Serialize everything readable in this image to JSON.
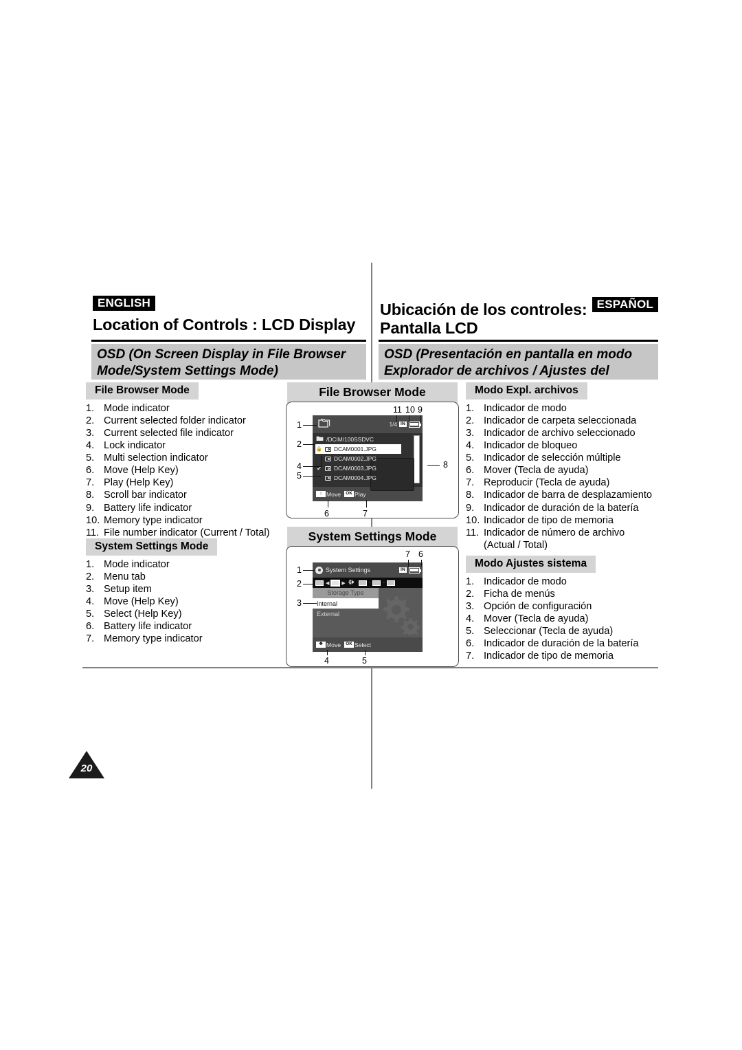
{
  "page": {
    "number": "20"
  },
  "header": {
    "english": {
      "badge": "ENGLISH",
      "title": "Location of Controls : LCD Display",
      "subtitle": "OSD (On Screen Display in File Browser Mode/System Settings Mode)"
    },
    "spanish": {
      "badge": "ESPAÑOL",
      "title_line1": "Ubicación de los controles:",
      "title_line2": "Pantalla LCD",
      "subtitle": "OSD (Presentación en pantalla en modo Explorador de archivos / Ajustes del sistema)"
    }
  },
  "sections": {
    "en_file_browser": {
      "title": "File Browser Mode",
      "items": [
        {
          "n": "1.",
          "t": "Mode indicator"
        },
        {
          "n": "2.",
          "t": "Current selected folder indicator"
        },
        {
          "n": "3.",
          "t": "Current selected file indicator"
        },
        {
          "n": "4.",
          "t": "Lock indicator"
        },
        {
          "n": "5.",
          "t": "Multi selection indicator"
        },
        {
          "n": "6.",
          "t": "Move (Help Key)"
        },
        {
          "n": "7.",
          "t": "Play (Help Key)"
        },
        {
          "n": "8.",
          "t": "Scroll bar indicator"
        },
        {
          "n": "9.",
          "t": "Battery life indicator"
        },
        {
          "n": "10.",
          "t": "Memory type indicator"
        },
        {
          "n": "11.",
          "t": "File number indicator (Current / Total)"
        }
      ]
    },
    "en_system_settings": {
      "title": "System Settings Mode",
      "items": [
        {
          "n": "1.",
          "t": "Mode indicator"
        },
        {
          "n": "2.",
          "t": "Menu tab"
        },
        {
          "n": "3.",
          "t": "Setup item"
        },
        {
          "n": "4.",
          "t": "Move (Help Key)"
        },
        {
          "n": "5.",
          "t": "Select (Help Key)"
        },
        {
          "n": "6.",
          "t": "Battery life indicator"
        },
        {
          "n": "7.",
          "t": "Memory type indicator"
        }
      ]
    },
    "es_file_browser": {
      "title": "Modo Expl. archivos",
      "items": [
        {
          "n": "1.",
          "t": "Indicador de modo"
        },
        {
          "n": "2.",
          "t": "Indicador de carpeta seleccionada"
        },
        {
          "n": "3.",
          "t": "Indicador de archivo seleccionado"
        },
        {
          "n": "4.",
          "t": "Indicador de bloqueo"
        },
        {
          "n": "5.",
          "t": "Indicador de selección múltiple"
        },
        {
          "n": "6.",
          "t": "Mover (Tecla de ayuda)"
        },
        {
          "n": "7.",
          "t": "Reproducir (Tecla de ayuda)"
        },
        {
          "n": "8.",
          "t": "Indicador de barra de desplazamiento"
        },
        {
          "n": "9.",
          "t": "Indicador de duración de la batería"
        },
        {
          "n": "10.",
          "t": "Indicador de tipo de memoria"
        },
        {
          "n": "11.",
          "t": "Indicador de número de archivo"
        },
        {
          "n": "",
          "t": "(Actual / Total)",
          "cont": true
        }
      ]
    },
    "es_system_settings": {
      "title": "Modo Ajustes sistema",
      "items": [
        {
          "n": "1.",
          "t": "Indicador de modo"
        },
        {
          "n": "2.",
          "t": "Ficha de menús"
        },
        {
          "n": "3.",
          "t": "Opción de configuración"
        },
        {
          "n": "4.",
          "t": "Mover (Tecla de ayuda)"
        },
        {
          "n": "5.",
          "t": "Seleccionar (Tecla de ayuda)"
        },
        {
          "n": "6.",
          "t": "Indicador de duración de la batería"
        },
        {
          "n": "7.",
          "t": "Indicador de tipo de memoria"
        }
      ]
    }
  },
  "diagrams": {
    "file_browser": {
      "heading": "File Browser Mode",
      "lcd": {
        "file_number": "1/4",
        "memory_badge": "IN",
        "path": "/DCIM/100SSDVC",
        "rows": [
          {
            "name": "DCAM0001.JPG",
            "mark": "lock",
            "selected": true
          },
          {
            "name": "DCAM0002.JPG",
            "mark": "",
            "selected": false
          },
          {
            "name": "DCAM0003.JPG",
            "mark": "check",
            "selected": false
          },
          {
            "name": "DCAM0004.JPG",
            "mark": "",
            "selected": false
          }
        ],
        "help_move_key": "",
        "help_move_label": "Move",
        "help_play_key": "OK",
        "help_play_label": "Play"
      },
      "callouts": [
        "1",
        "2",
        "4",
        "5",
        "6",
        "7",
        "8",
        "9",
        "10",
        "11"
      ]
    },
    "system_settings": {
      "heading": "System Settings Mode",
      "lcd": {
        "title": "System Settings",
        "memory_badge": "IN",
        "panel_title": "Storage Type",
        "options": [
          {
            "label": "Internal",
            "selected": true
          },
          {
            "label": "External",
            "selected": false
          }
        ],
        "help_move_key": "",
        "help_move_label": "Move",
        "help_select_key": "OK",
        "help_select_label": "Select"
      },
      "callouts": [
        "1",
        "2",
        "3",
        "4",
        "5",
        "6",
        "7"
      ]
    }
  },
  "colors": {
    "band_gray": "#c6c6c6",
    "section_gray": "#d4d4d4",
    "lcd_dark": "#3d3d3d",
    "rule_black": "#000000",
    "divider_gray": "#808080"
  }
}
